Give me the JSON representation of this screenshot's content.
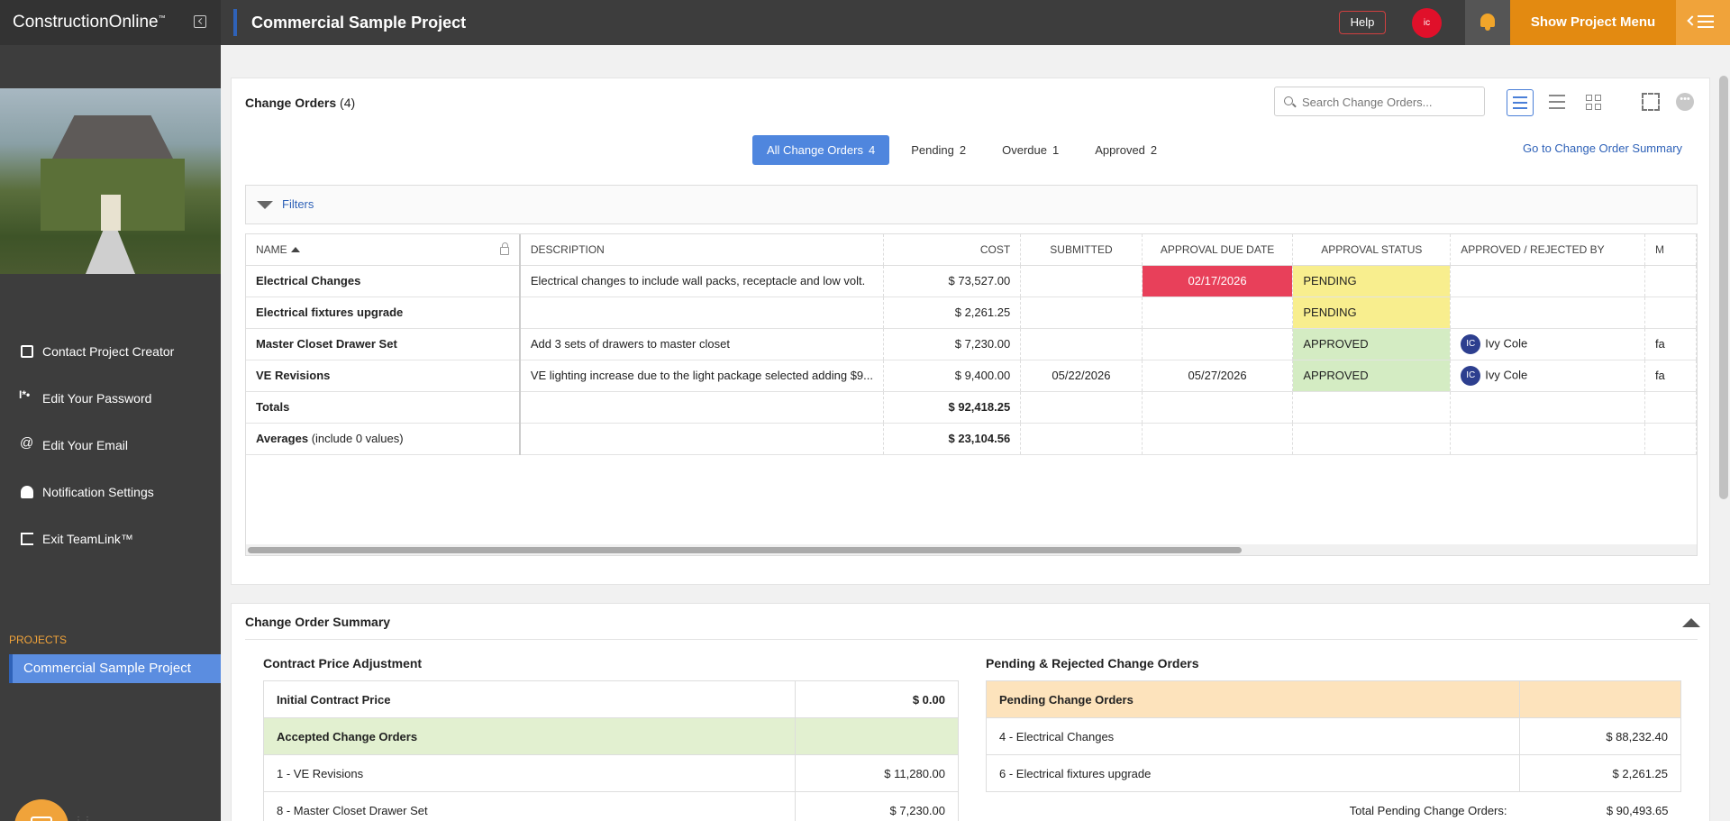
{
  "app": {
    "logo": "ConstructionOnline",
    "logo_tm": "™",
    "project_title": "Commercial Sample Project",
    "help_label": "Help",
    "user_initials": "ic",
    "show_menu_label": "Show Project Menu"
  },
  "sidebar": {
    "links": [
      {
        "label": "Contact Project Creator",
        "icon": "envelope-icon"
      },
      {
        "label": "Edit Your Password",
        "icon": "password-icon"
      },
      {
        "label": "Edit Your Email",
        "icon": "at-sign-icon"
      },
      {
        "label": "Notification Settings",
        "icon": "bell-icon"
      },
      {
        "label": "Exit TeamLink™",
        "icon": "exit-icon"
      }
    ],
    "projects_label": "PROJECTS",
    "active_project": "Commercial Sample Project"
  },
  "change_orders": {
    "title": "Change Orders",
    "count": "(4)",
    "search_placeholder": "Search Change Orders...",
    "tabs": [
      {
        "label": "All Change Orders",
        "count": "4"
      },
      {
        "label": "Pending",
        "count": "2"
      },
      {
        "label": "Overdue",
        "count": "1"
      },
      {
        "label": "Approved",
        "count": "2"
      }
    ],
    "goto_summary": "Go to Change Order Summary",
    "filters_label": "Filters",
    "columns": [
      "NAME",
      "DESCRIPTION",
      "COST",
      "SUBMITTED",
      "APPROVAL DUE DATE",
      "APPROVAL STATUS",
      "APPROVED / REJECTED BY",
      "M"
    ],
    "rows": [
      {
        "name": "Electrical Changes",
        "description": "Electrical changes to include wall packs, receptacle and low volt.",
        "cost": "$ 73,527.00",
        "submitted": "",
        "due": "02/17/2026",
        "status": "PENDING",
        "by_initials": "",
        "by": "",
        "m": ""
      },
      {
        "name": "Electrical fixtures upgrade",
        "description": "",
        "cost": "$ 2,261.25",
        "submitted": "",
        "due": "",
        "status": "PENDING",
        "by_initials": "",
        "by": "",
        "m": ""
      },
      {
        "name": "Master Closet Drawer Set",
        "description": "Add 3 sets of drawers to master closet",
        "cost": "$ 7,230.00",
        "submitted": "",
        "due": "",
        "status": "APPROVED",
        "by_initials": "IC",
        "by": "Ivy Cole",
        "m": "fa"
      },
      {
        "name": "VE Revisions",
        "description": "VE lighting increase due to the light package selected adding $9...",
        "cost": "$ 9,400.00",
        "submitted": "05/22/2026",
        "due": "05/27/2026",
        "status": "APPROVED",
        "by_initials": "IC",
        "by": "Ivy Cole",
        "m": "fa"
      }
    ],
    "totals_label": "Totals",
    "totals_cost": "$ 92,418.25",
    "averages_label": "Averages",
    "averages_note": "(include 0 values)",
    "averages_cost": "$ 23,104.56"
  },
  "summary": {
    "title": "Change Order Summary",
    "left_title": "Contract Price Adjustment",
    "initial_label": "Initial Contract Price",
    "initial_value": "$ 0.00",
    "accepted_label": "Accepted Change Orders",
    "accepted_rows": [
      {
        "label": "1 - VE Revisions",
        "value": "$ 11,280.00"
      },
      {
        "label": "8 - Master Closet Drawer Set",
        "value": "$ 7,230.00"
      }
    ],
    "right_title": "Pending & Rejected Change Orders",
    "pending_label": "Pending Change Orders",
    "pending_rows": [
      {
        "label": "4 - Electrical Changes",
        "value": "$ 88,232.40"
      },
      {
        "label": "6 - Electrical fixtures upgrade",
        "value": "$ 2,261.25"
      }
    ],
    "total_pending_label": "Total Pending Change Orders:",
    "total_pending_value": "$ 90,493.65"
  }
}
